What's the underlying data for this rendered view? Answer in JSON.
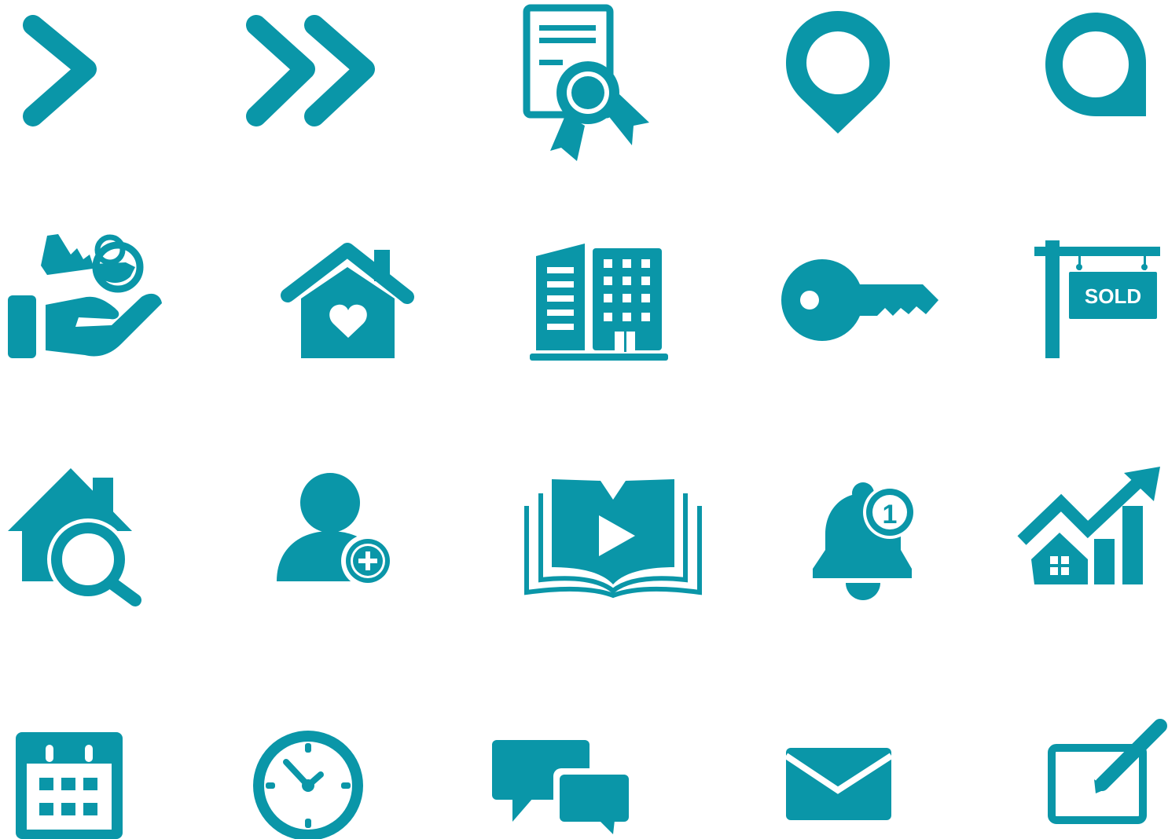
{
  "colors": {
    "icon": "#0a96a8",
    "background": "#ffffff"
  },
  "icons": [
    {
      "name": "chevron-right-icon"
    },
    {
      "name": "double-chevron-right-icon"
    },
    {
      "name": "certificate-icon"
    },
    {
      "name": "location-pin-icon"
    },
    {
      "name": "location-pin-corner-icon"
    },
    {
      "name": "hand-key-icon"
    },
    {
      "name": "house-heart-icon"
    },
    {
      "name": "office-building-icon"
    },
    {
      "name": "key-icon"
    },
    {
      "name": "sold-sign-icon"
    },
    {
      "name": "house-search-icon"
    },
    {
      "name": "add-user-icon"
    },
    {
      "name": "video-book-icon"
    },
    {
      "name": "notification-bell-icon"
    },
    {
      "name": "property-growth-chart-icon"
    },
    {
      "name": "calendar-icon"
    },
    {
      "name": "clock-icon"
    },
    {
      "name": "chat-bubbles-icon"
    },
    {
      "name": "envelope-icon"
    },
    {
      "name": "edit-tablet-icon"
    }
  ],
  "sold_sign": {
    "text": "SOLD"
  },
  "notification_bell": {
    "badge": "1"
  }
}
